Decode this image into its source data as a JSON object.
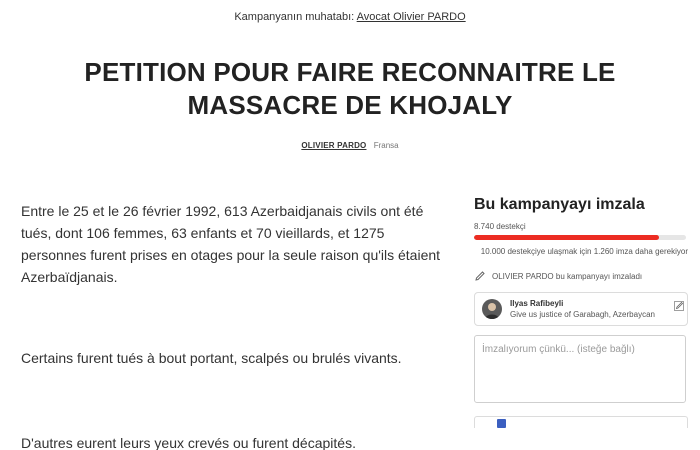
{
  "header": {
    "recipient_label": "Kampanyanın muhatabı:",
    "recipient_name": "Avocat Olivier PARDO"
  },
  "petition": {
    "title": "PETITION POUR FAIRE RECONNAITRE LE MASSACRE DE KHOJALY",
    "author": "OLIVIER PARDO",
    "country": "Fransa"
  },
  "body": {
    "paragraphs": [
      "Entre le 25 et le 26 février 1992, 613 Azerbaidjanais civils ont été tués, dont 106 femmes, 63 enfants et 70 vieillards, et 1275 personnes furent prises en otages pour la seule raison qu'ils étaient Azerbaïdjanais.",
      "Certains furent tués à bout portant, scalpés ou brulés vivants.",
      "D'autres eurent leurs yeux crevés ou furent décapités."
    ]
  },
  "sidebar": {
    "sign_title": "Bu kampanyayı imzala",
    "supporters_count": "8.740 destekçi",
    "progress_fraction": 0.874,
    "goal_text": "10.000 destekçiye ulaşmak için 1.260 imza daha gerekiyor",
    "started_text": "OLIVIER PARDO bu kampanyayı imzaladı",
    "recent_signer": {
      "name": "Ilyas Rafibeyli",
      "comment": "Give us justice of Garabagh, Azerbaycan"
    },
    "comment_placeholder": "İmzalıyorum çünkü... (isteğe bağlı)"
  },
  "colors": {
    "progress": "#ec2c22",
    "checkbox": "#3b5fc0"
  },
  "icons": {
    "started": "pencil-icon",
    "signer_edit": "edit-icon"
  }
}
